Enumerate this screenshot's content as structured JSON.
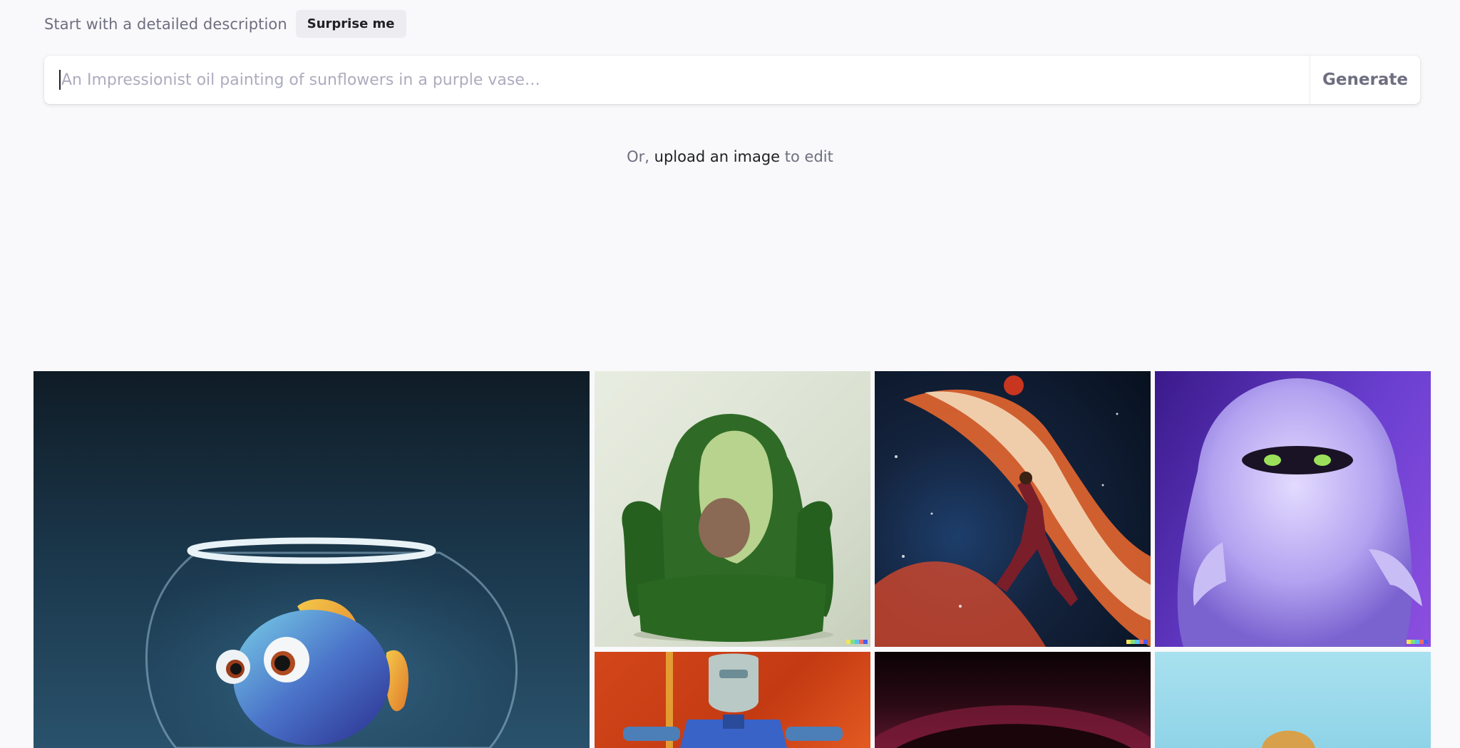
{
  "header": {
    "intro_text": "Start with a detailed description",
    "surprise_label": "Surprise me"
  },
  "prompt": {
    "placeholder": "An Impressionist oil painting of sunflowers in a purple vase…",
    "value": "",
    "generate_label": "Generate"
  },
  "upload": {
    "prefix": "Or, ",
    "link_label": "upload an image",
    "suffix": " to edit"
  },
  "colors": {
    "background": "#f9f9fb",
    "muted_text": "#6e6e80",
    "dark_text": "#202123"
  },
  "gallery": {
    "tiles": [
      {
        "subject": "fish in a fishbowl"
      },
      {
        "subject": "avocado armchair"
      },
      {
        "subject": "basketball player in space painting"
      },
      {
        "subject": "fluffy purple monster"
      },
      {
        "subject": "robot painting"
      },
      {
        "subject": "dark abstract"
      },
      {
        "subject": "light blue scene"
      }
    ]
  }
}
